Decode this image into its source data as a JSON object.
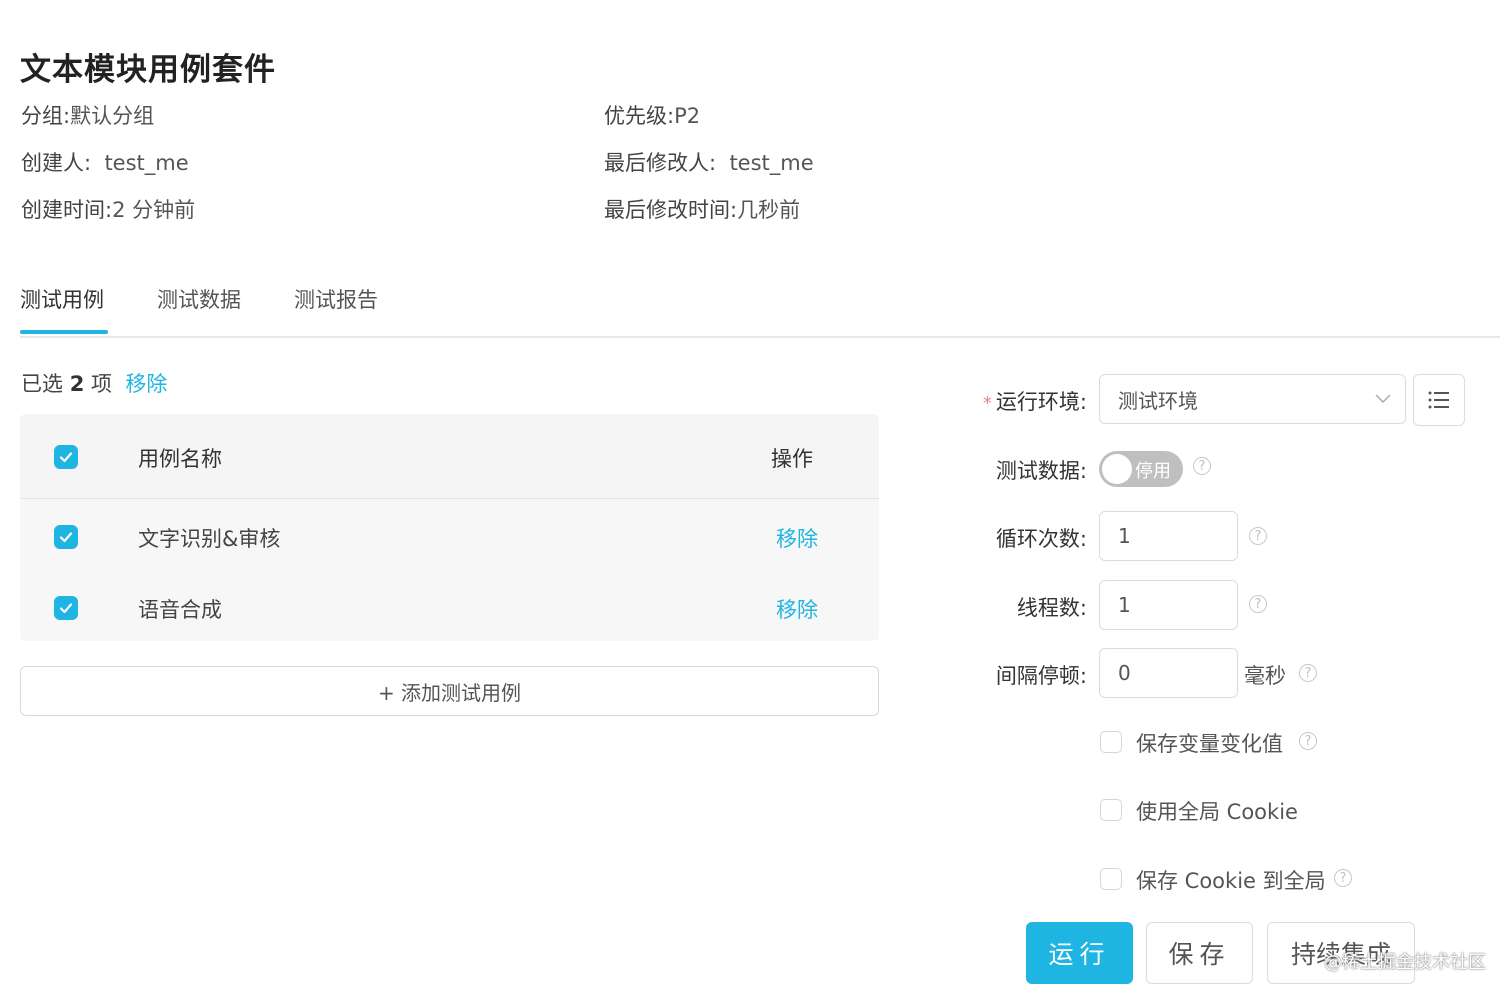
{
  "page": {
    "title": "文本模块用例套件"
  },
  "meta": {
    "group_label": "分组:",
    "group_value": "默认分组",
    "priority_label": "优先级:",
    "priority_value": "P2",
    "creator_label": "创建人:",
    "creator_value": "test_me",
    "modifier_label": "最后修改人:",
    "modifier_value": "test_me",
    "created_label": "创建时间:",
    "created_value": "2 分钟前",
    "modified_label": "最后修改时间:",
    "modified_value": "几秒前"
  },
  "tabs": [
    {
      "label": "测试用例",
      "active": true
    },
    {
      "label": "测试数据",
      "active": false
    },
    {
      "label": "测试报告",
      "active": false
    }
  ],
  "selection": {
    "prefix": "已选",
    "count": "2",
    "suffix": "项",
    "remove": "移除"
  },
  "table": {
    "col_name": "用例名称",
    "col_op": "操作",
    "rows": [
      {
        "name": "文字识别&审核",
        "op": "移除",
        "checked": true
      },
      {
        "name": "语音合成",
        "op": "移除",
        "checked": true
      }
    ]
  },
  "add_case": {
    "icon": "plus-icon",
    "label": "+ 添加测试用例"
  },
  "form": {
    "env_label": "运行环境:",
    "env_value": "测试环境",
    "env_required": "*",
    "data_label": "测试数据:",
    "data_switch": "停用",
    "data_switch_on": false,
    "loop_label": "循环次数:",
    "loop_value": "1",
    "thread_label": "线程数:",
    "thread_value": "1",
    "interval_label": "间隔停顿:",
    "interval_value": "0",
    "interval_unit": "毫秒",
    "opt_save_var": "保存变量变化值",
    "opt_global_cookie": "使用全局 Cookie",
    "opt_save_cookie": "保存 Cookie 到全局"
  },
  "buttons": {
    "run": "运行",
    "save": "保存",
    "ci": "持续集成"
  },
  "watermark": "@稀土掘金技术社区",
  "colors": {
    "accent": "#1fb5e2",
    "switch_off": "#bfbfbf"
  }
}
